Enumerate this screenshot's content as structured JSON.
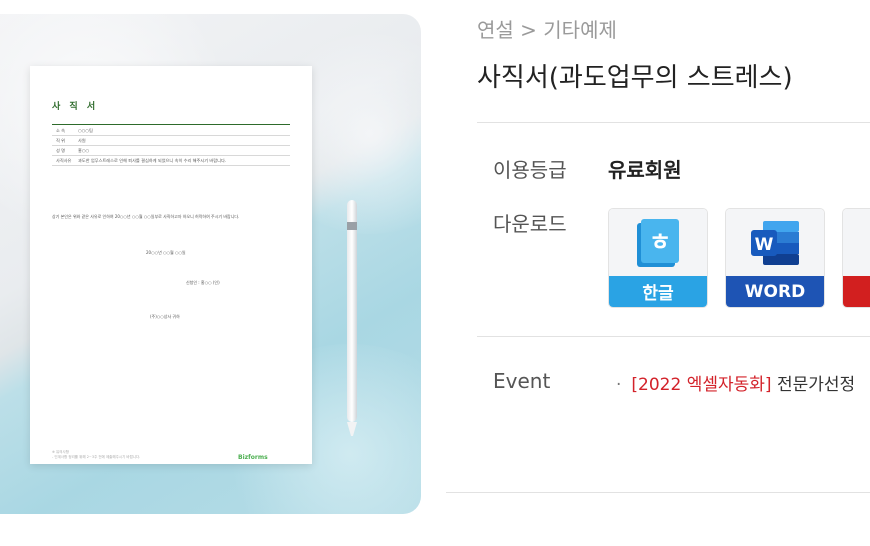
{
  "breadcrumb": "연설 > 기타예제",
  "title": "사직서(과도업무의 스트레스)",
  "grade": {
    "label": "이용등급",
    "value": "유료회원"
  },
  "download": {
    "label": "다운로드",
    "buttons": [
      {
        "label": "한글",
        "icon": "hangul-icon",
        "color": "#2aa3e4"
      },
      {
        "label": "WORD",
        "icon": "word-icon",
        "color": "#1e54b4"
      },
      {
        "label": "",
        "icon": "pdf-icon",
        "color": "#d21f1f"
      }
    ]
  },
  "event": {
    "label": "Event",
    "tag": "[2022 엑셀자동화]",
    "text": "전문가선정"
  },
  "doc": {
    "title": "사 직 서",
    "rows": [
      {
        "k": "소 속",
        "v": "○○○팀"
      },
      {
        "k": "직 위",
        "v": "사원"
      },
      {
        "k": "성 명",
        "v": "홍○○"
      },
      {
        "k": "사직사유",
        "v": "과도한 업무스트레스로 인해 퇴사를 결심하게 되었으니 속히 수리 해주시기 바랍니다."
      }
    ],
    "body": "상기 본인은 위와 같은 사유로 인하여 20○○년 ○○월 ○○일부로 사직하고자 하오니 허락하여 주시기 바랍니다.",
    "date": "20○○년 ○○월 ○○일",
    "sign": "신청인 :      홍○○       (인)",
    "to": "(주)○○상사  귀하",
    "foot1": "※ 유의사항",
    "foot2": "- 인계사항 정리를 위해 2~3주 전에 제출해주시기 바랍니다.",
    "brand": "Bizforms"
  }
}
